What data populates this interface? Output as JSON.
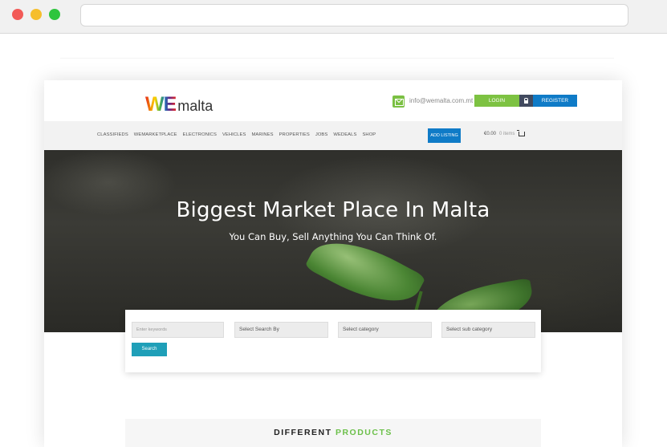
{
  "header": {
    "logo_we": "WE",
    "logo_malta": "malta",
    "email": "info@wemalta.com.mt",
    "login_label": "LOGIN",
    "register_label": "REGISTER"
  },
  "nav": {
    "items": [
      "CLASSIFIEDS",
      "WEMARKETPLACE",
      "ELECTRONICS",
      "VEHICLES",
      "MARINES",
      "PROPERTIES",
      "JOBS",
      "WEDEALS",
      "SHOP"
    ],
    "add_listing_label": "ADD LISTING",
    "cart_total": "€0.00",
    "cart_items": "0 items"
  },
  "hero": {
    "title": "Biggest Market Place In Malta",
    "subtitle": "You Can Buy, Sell Anything You Can Think Of."
  },
  "search": {
    "keywords_placeholder": "Enter keywords",
    "search_by": "Select Search By",
    "category": "Select category",
    "sub_category": "Select sub category",
    "button_label": "Search"
  },
  "section": {
    "title_part1": "DIFFERENT",
    "title_part2": "PRODUCTS"
  },
  "colors": {
    "green": "#7dc242",
    "blue": "#0f7bc7",
    "teal": "#1f9fb8"
  }
}
